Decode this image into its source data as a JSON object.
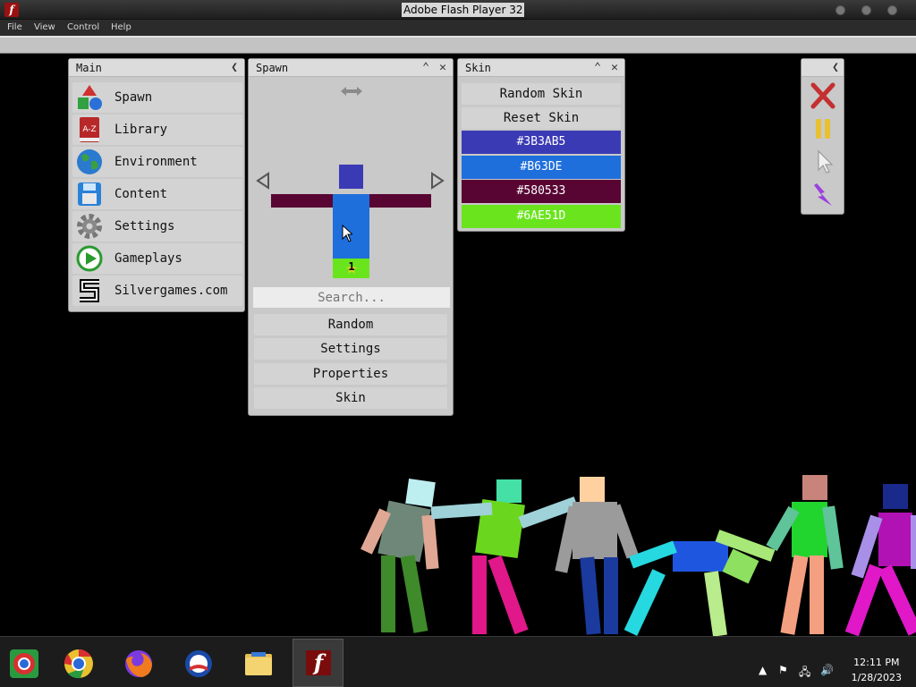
{
  "window": {
    "title": "Adobe Flash Player 32"
  },
  "menu": [
    "File",
    "View",
    "Control",
    "Help"
  ],
  "main_panel": {
    "title": "Main",
    "items": [
      {
        "label": "Spawn"
      },
      {
        "label": "Library"
      },
      {
        "label": "Environment"
      },
      {
        "label": "Content"
      },
      {
        "label": "Settings"
      },
      {
        "label": "Gameplays"
      },
      {
        "label": "Silvergames.com"
      }
    ]
  },
  "spawn_panel": {
    "title": "Spawn",
    "count": "1",
    "search_placeholder": "Search...",
    "buttons": [
      "Random",
      "Settings",
      "Properties",
      "Skin"
    ]
  },
  "skin_panel": {
    "title": "Skin",
    "buttons": [
      "Random Skin",
      "Reset Skin"
    ],
    "swatches": [
      {
        "label": "#3B3AB5",
        "color": "#3B3AB5"
      },
      {
        "label": "#B63DE",
        "color": "#1E6FDC"
      },
      {
        "label": "#580533",
        "color": "#580533"
      },
      {
        "label": "#6AE51D",
        "color": "#6AE51D"
      }
    ]
  },
  "colors": {
    "head": "#3B3AB5",
    "body": "#1E6FDC",
    "arms": "#580533",
    "legs": "#6AE51D"
  },
  "taskbar": {
    "time": "12:11 PM",
    "date": "1/28/2023"
  }
}
